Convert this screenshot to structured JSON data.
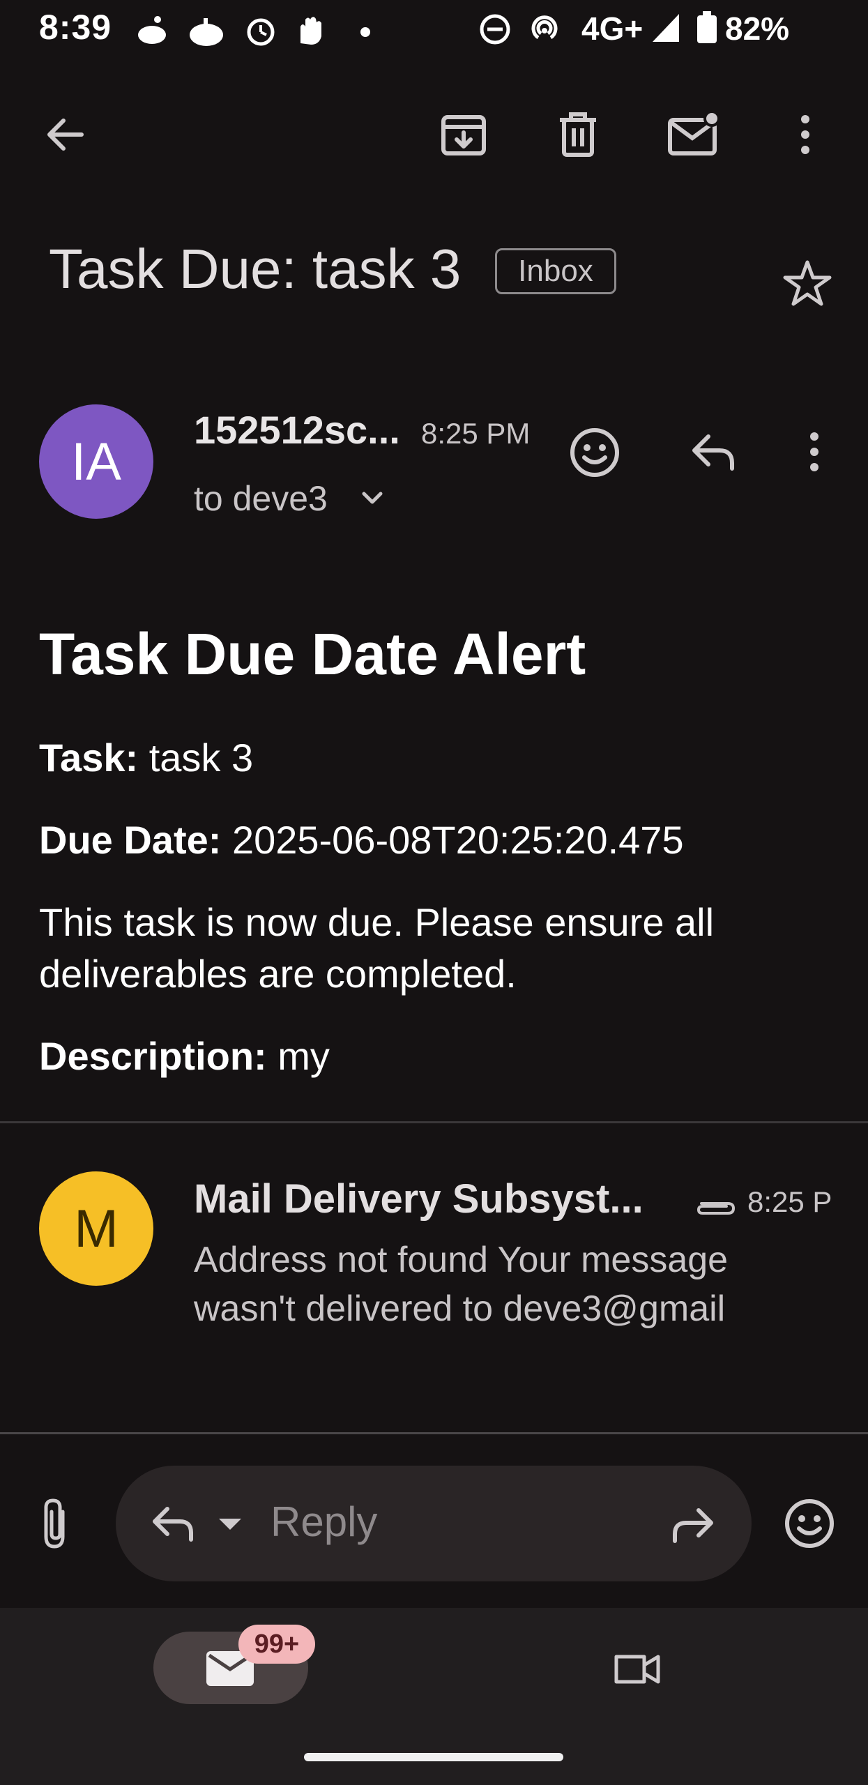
{
  "status_bar": {
    "time": "8:39",
    "network": "4G+",
    "battery": "82%"
  },
  "toolbar": {
    "back": "back-arrow-icon",
    "archive": "archive-icon",
    "delete": "trash-icon",
    "mark_unread": "mark-unread-icon",
    "more": "more-vert-icon"
  },
  "thread": {
    "subject": "Task Due: task 3",
    "label": "Inbox"
  },
  "message1": {
    "avatar_initials": "IA",
    "avatar_color": "#7e57c2",
    "sender": "152512sc...",
    "time": "8:25 PM",
    "to": "to deve3",
    "heading": "Task Due Date Alert",
    "task_label": "Task:",
    "task_value": "task 3",
    "due_label": "Due Date:",
    "due_value": "2025-06-08T20:25:20.475",
    "body_line1": "This task is now due. Please ensure all",
    "body_line2": "deliverables are completed.",
    "desc_label": "Description:",
    "desc_value": "my"
  },
  "message2": {
    "avatar_initials": "M",
    "avatar_color": "#f6bf26",
    "sender": "Mail Delivery Subsyst...",
    "time": "8:25 P",
    "snippet_line1": "Address not found Your message",
    "snippet_line2": "wasn't delivered to deve3@gmail"
  },
  "reply_bar": {
    "placeholder": "Reply"
  },
  "bottom_nav": {
    "mail_badge": "99+"
  }
}
